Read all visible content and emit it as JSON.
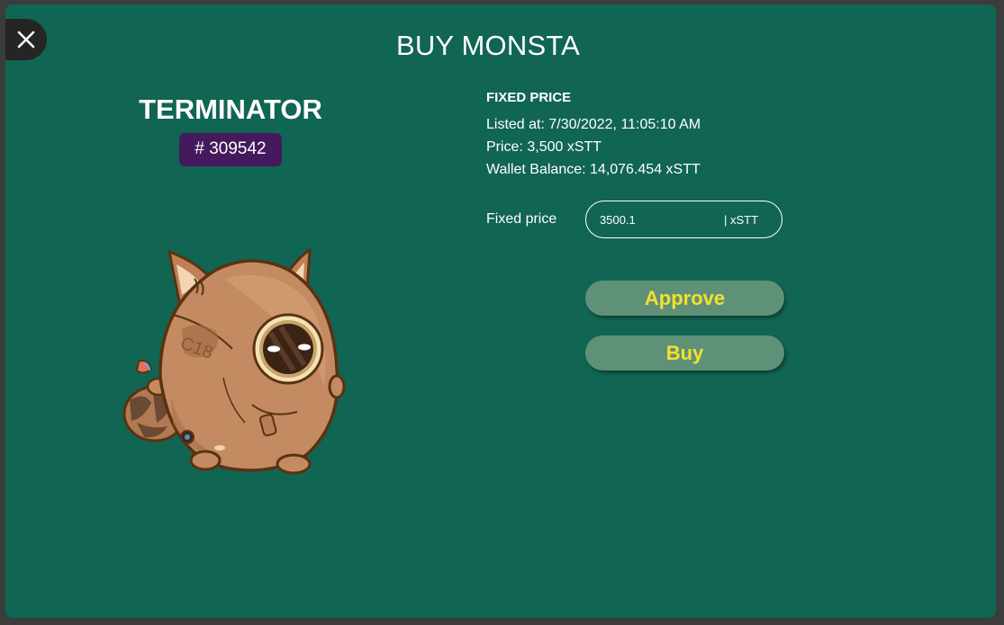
{
  "modal": {
    "title": "BUY MONSTA",
    "close_icon": "close-icon"
  },
  "monsta": {
    "name": "TERMINATOR",
    "id": "# 309542",
    "image": "raccoon-monsta-illustration"
  },
  "listing": {
    "heading": "FIXED PRICE",
    "listed_at": "Listed at: 7/30/2022, 11:05:10 AM",
    "price": "Price: 3,500 xSTT",
    "wallet_balance": "Wallet Balance: 14,076.454 xSTT"
  },
  "price_input": {
    "label": "Fixed price",
    "value": "3500.1",
    "unit": "| xSTT"
  },
  "actions": {
    "approve_label": "Approve",
    "buy_label": "Buy"
  },
  "colors": {
    "modal_bg": "#116553",
    "id_badge": "#451a5c",
    "button_bg": "#5f9178",
    "button_text": "#f3e12c"
  }
}
